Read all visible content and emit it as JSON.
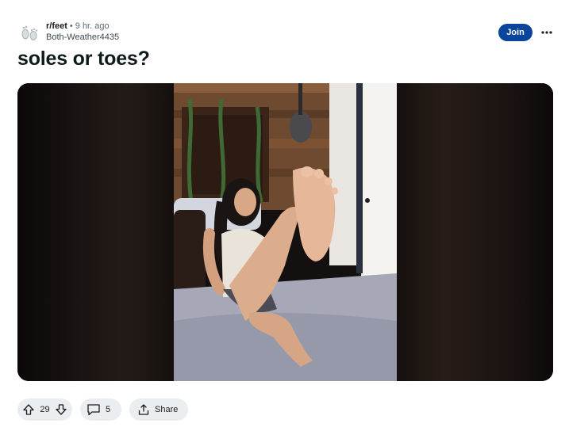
{
  "post": {
    "subreddit": "r/feet",
    "separator": "•",
    "time_ago": "9 hr. ago",
    "author": "Both-Weather4435",
    "title": "soles or toes?",
    "join_label": "Join",
    "more_icon": "ellipsis-icon"
  },
  "actions": {
    "upvote_icon": "arrow-up-icon",
    "score": "29",
    "downvote_icon": "arrow-down-icon",
    "comment_icon": "speech-bubble-icon",
    "comment_count": "5",
    "share_icon": "share-icon",
    "share_label": "Share"
  },
  "colors": {
    "join_button": "#0a449b",
    "pill_background": "#eaeef0",
    "title_text": "#0f1a1c",
    "meta_text": "#5c6c74"
  }
}
